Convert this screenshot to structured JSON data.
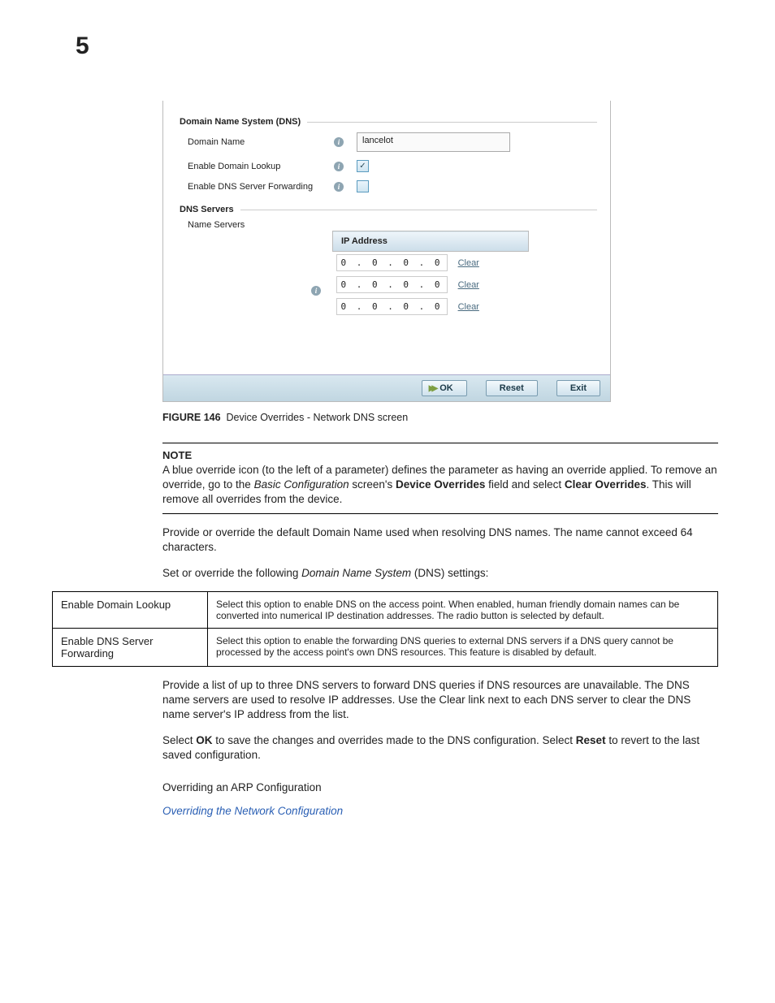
{
  "chapter": "5",
  "screenshot": {
    "fs1_title": "Domain Name System (DNS)",
    "domain_label": "Domain Name",
    "domain_value": "lancelot",
    "enable_lookup_label": "Enable Domain Lookup",
    "enable_lookup_checked": "✓",
    "enable_fwd_label": "Enable DNS Server Forwarding",
    "fs2_title": "DNS Servers",
    "ns_label": "Name Servers",
    "ip_header": "IP Address",
    "ips": [
      "0 . 0 . 0 . 0",
      "0 . 0 . 0 . 0",
      "0 . 0 . 0 . 0"
    ],
    "clear": "Clear",
    "btn_ok": "OK",
    "btn_reset": "Reset",
    "btn_exit": "Exit"
  },
  "caption_prefix": "FIGURE 146",
  "caption_text": "Device Overrides - Network DNS screen",
  "note_label": "NOTE",
  "note_p1a": "A blue override icon (to the left of a parameter) defines the parameter as having an override applied. To remove an override, go to the ",
  "note_p1_i1": "Basic Configuration",
  "note_p1b": " screen's ",
  "note_p1_b1": "Device Overrides",
  "note_p1c": " field and select ",
  "note_p1_b2": "Clear Overrides",
  "note_p1d": ". This will remove all overrides from the device.",
  "para2": "Provide or override the default Domain Name used when resolving DNS names. The name cannot exceed 64 characters.",
  "para3a": "Set or override the following ",
  "para3i": "Domain Name System",
  "para3b": " (DNS) settings:",
  "table": {
    "r1_left": "Enable Domain Lookup",
    "r1_right": "Select this option to enable DNS on the access point. When enabled, human friendly domain names can be converted into numerical IP destination addresses. The radio button is selected by default.",
    "r2_left": "Enable DNS Server Forwarding",
    "r2_right": "Select this option to enable the forwarding DNS queries to external DNS servers if a DNS query cannot be processed by the access point's own DNS resources. This feature is disabled by default."
  },
  "para4": "Provide a list of up to three DNS servers to forward DNS queries if DNS resources are unavailable. The DNS name servers are used to resolve IP addresses. Use the Clear link next to each DNS server to clear the DNS name server's IP address from the list.",
  "para5a": "Select ",
  "para5b1": "OK",
  "para5b": " to save the changes and overrides made to the DNS configuration. Select ",
  "para5b2": "Reset",
  "para5c": " to revert to the last saved configuration.",
  "sec_head": "Overriding an ARP Configuration",
  "link": "Overriding the Network Configuration"
}
